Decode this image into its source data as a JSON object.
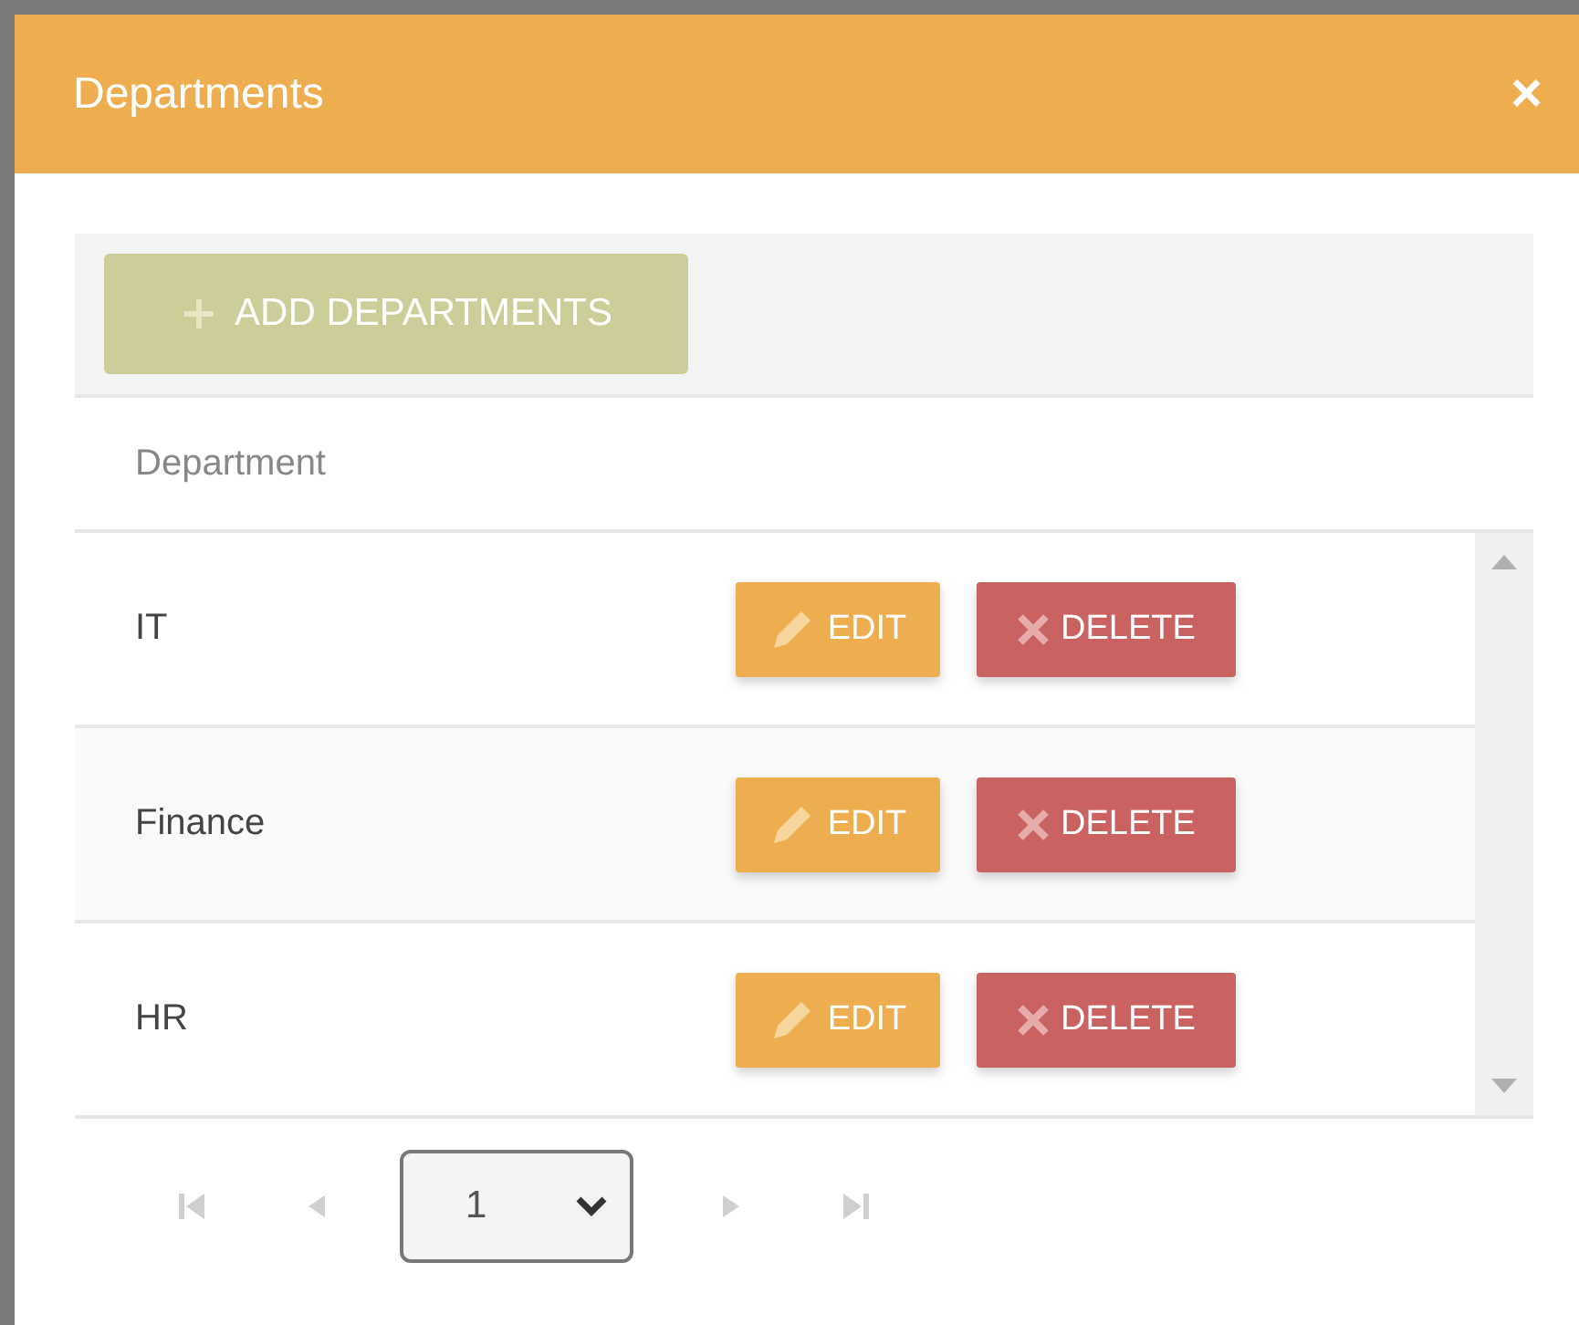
{
  "window": {
    "title": "Departments",
    "close": "×"
  },
  "toolbar": {
    "add_button": "ADD DEPARTMENTS"
  },
  "table": {
    "columns": [
      "Department"
    ],
    "rows": [
      {
        "name": "IT",
        "edit": "EDIT",
        "delete": "DELETE"
      },
      {
        "name": "Finance",
        "edit": "EDIT",
        "delete": "DELETE"
      },
      {
        "name": "HR",
        "edit": "EDIT",
        "delete": "DELETE"
      }
    ]
  },
  "pager": {
    "page": "1",
    "first_disabled": true,
    "prev_disabled": true,
    "next_disabled": true,
    "last_disabled": true
  }
}
